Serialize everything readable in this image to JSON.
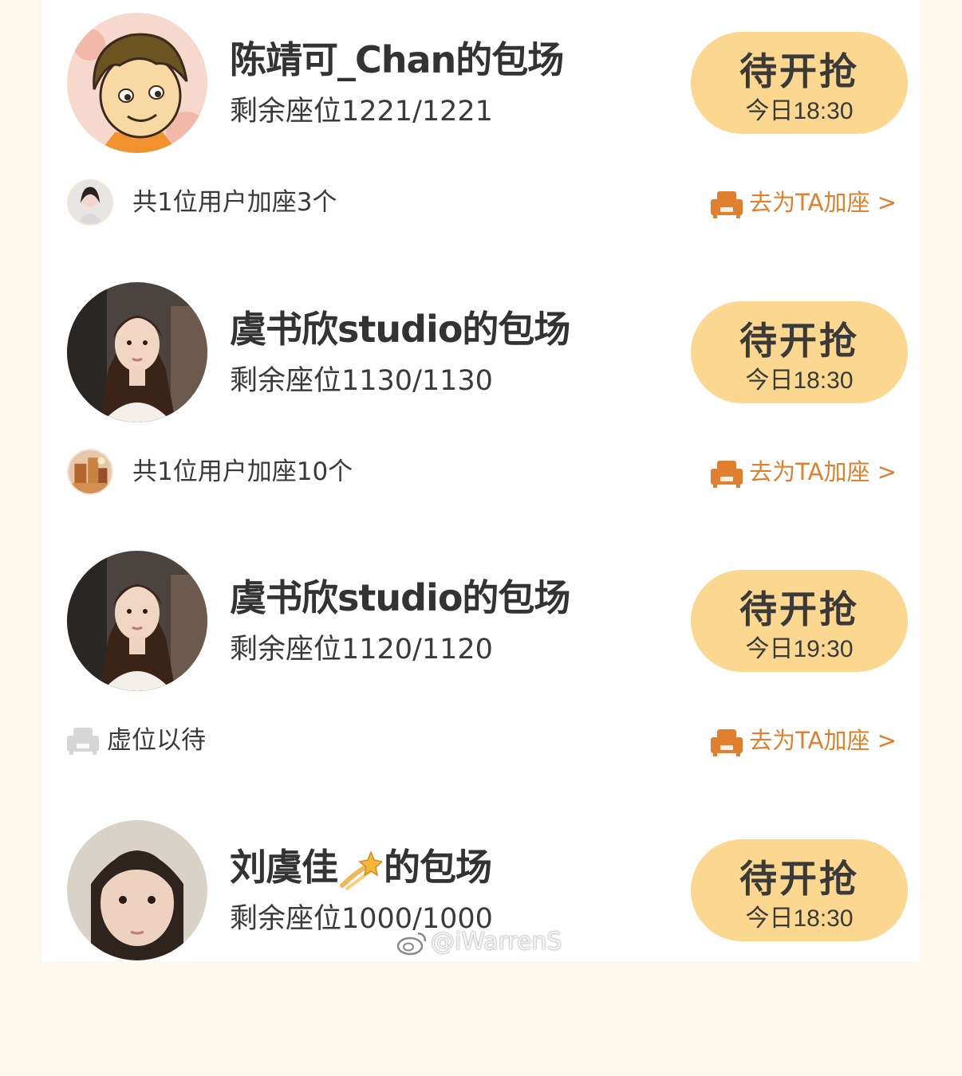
{
  "colors": {
    "page_bg": "#fdf7ec",
    "card_bg": "#ffffff",
    "button_bg": "#fbd78f",
    "accent_orange": "#e0802e",
    "text_dark": "#333333"
  },
  "sessions": [
    {
      "title": "陈靖可_Chan的包场",
      "seats": "剩余座位1221/1221",
      "button": {
        "label": "待开抢",
        "time": "今日18:30"
      },
      "add_info": "共1位用户加座3个",
      "add_link": "去为TA加座 >",
      "avatar_icon": "cartoon-boy-avatar"
    },
    {
      "title": "虞书欣studio的包场",
      "seats": "剩余座位1130/1130",
      "button": {
        "label": "待开抢",
        "time": "今日18:30"
      },
      "add_info": "共1位用户加座10个",
      "add_link": "去为TA加座 >",
      "avatar_icon": "woman-photo-avatar"
    },
    {
      "title": "虞书欣studio的包场",
      "seats": "剩余座位1120/1120",
      "button": {
        "label": "待开抢",
        "time": "今日19:30"
      },
      "vacant": "虚位以待",
      "add_link": "去为TA加座 >",
      "avatar_icon": "woman-photo-avatar"
    },
    {
      "title_before": "刘虞佳",
      "title_after": "的包场",
      "title_emoji": "dizzy-star-emoji",
      "seats": "剩余座位1000/1000",
      "button": {
        "label": "待开抢",
        "time": "今日18:30"
      },
      "avatar_icon": "girl-photo-avatar"
    }
  ],
  "watermark": "@iWarrenS"
}
